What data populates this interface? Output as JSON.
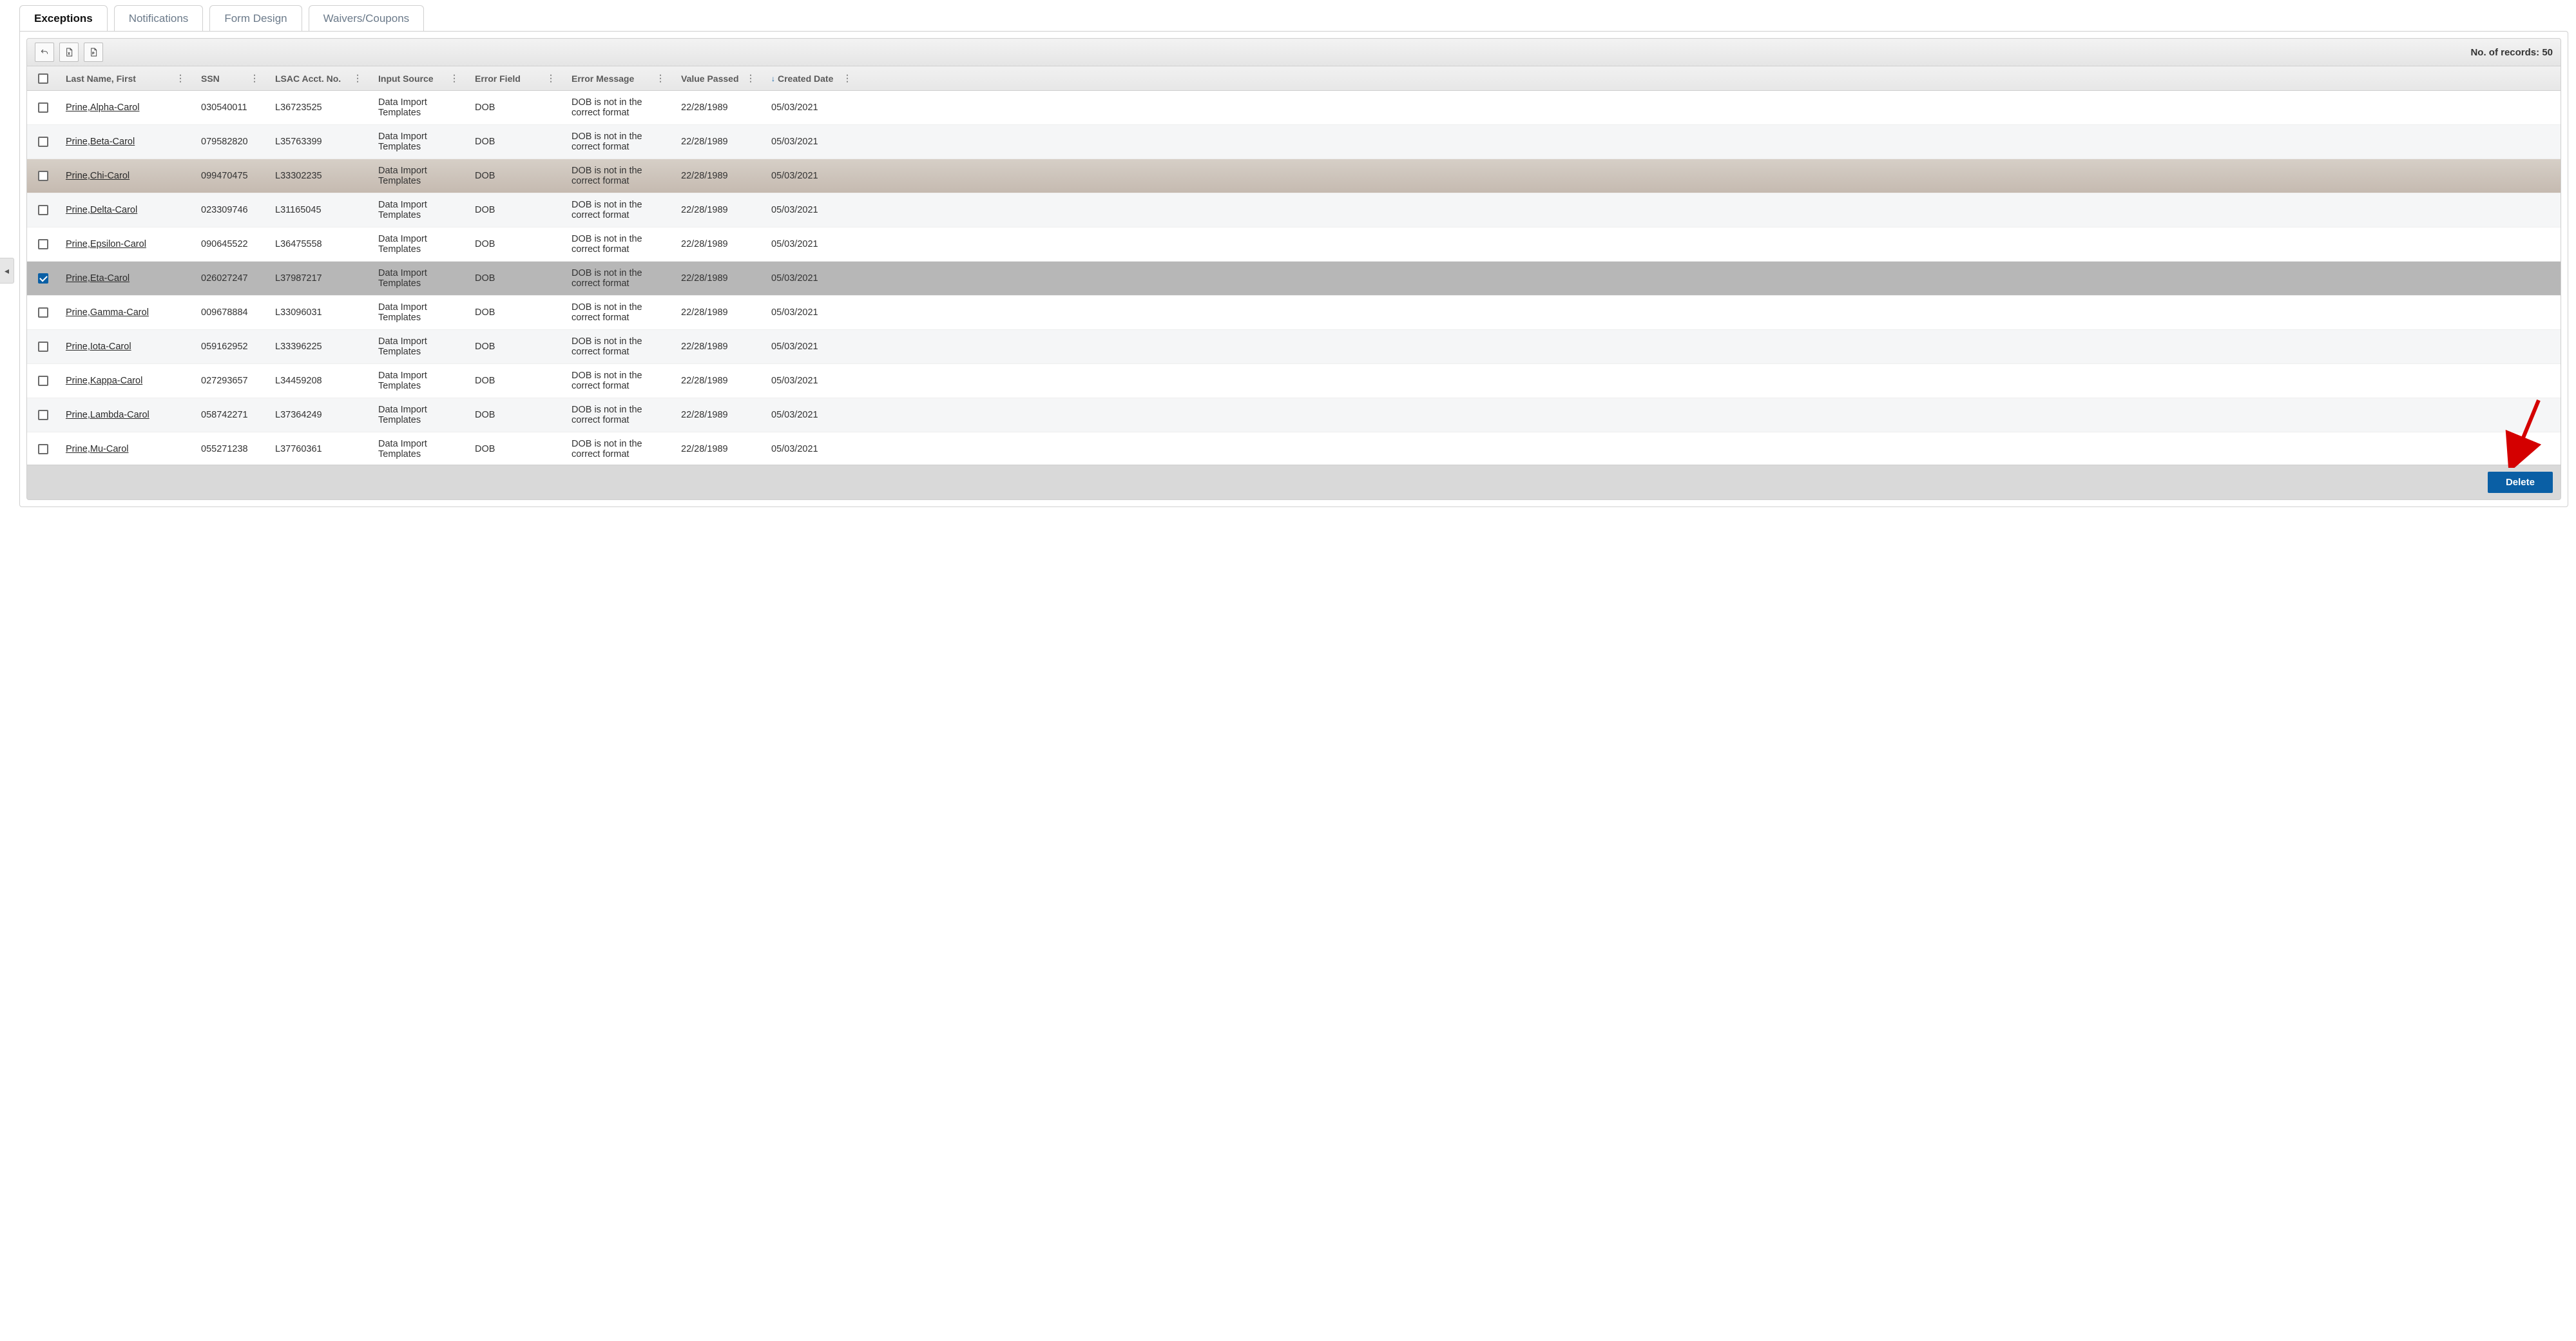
{
  "tabs": {
    "items": [
      {
        "label": "Exceptions",
        "active": true
      },
      {
        "label": "Notifications",
        "active": false
      },
      {
        "label": "Form Design",
        "active": false
      },
      {
        "label": "Waivers/Coupons",
        "active": false
      }
    ]
  },
  "toolbar": {
    "records_label": "No. of records:",
    "records_count": "50"
  },
  "columns": {
    "name": "Last Name, First",
    "ssn": "SSN",
    "lsac": "LSAC Acct. No.",
    "input": "Input Source",
    "err": "Error Field",
    "msg": "Error Message",
    "val": "Value Passed",
    "date": "Created Date"
  },
  "sort": {
    "column": "date",
    "dir": "asc"
  },
  "rows": [
    {
      "checked": false,
      "state": "",
      "name": "Prine,Alpha-Carol",
      "ssn": "030540011",
      "lsac": "L36723525",
      "input": "Data Import Templates",
      "err": "DOB",
      "msg": "DOB is not in the correct format",
      "val": "22/28/1989",
      "date": "05/03/2021"
    },
    {
      "checked": false,
      "state": "",
      "name": "Prine,Beta-Carol",
      "ssn": "079582820",
      "lsac": "L35763399",
      "input": "Data Import Templates",
      "err": "DOB",
      "msg": "DOB is not in the correct format",
      "val": "22/28/1989",
      "date": "05/03/2021"
    },
    {
      "checked": false,
      "state": "hover",
      "name": "Prine,Chi-Carol",
      "ssn": "099470475",
      "lsac": "L33302235",
      "input": "Data Import Templates",
      "err": "DOB",
      "msg": "DOB is not in the correct format",
      "val": "22/28/1989",
      "date": "05/03/2021"
    },
    {
      "checked": false,
      "state": "",
      "name": "Prine,Delta-Carol",
      "ssn": "023309746",
      "lsac": "L31165045",
      "input": "Data Import Templates",
      "err": "DOB",
      "msg": "DOB is not in the correct format",
      "val": "22/28/1989",
      "date": "05/03/2021"
    },
    {
      "checked": false,
      "state": "",
      "name": "Prine,Epsilon-Carol",
      "ssn": "090645522",
      "lsac": "L36475558",
      "input": "Data Import Templates",
      "err": "DOB",
      "msg": "DOB is not in the correct format",
      "val": "22/28/1989",
      "date": "05/03/2021"
    },
    {
      "checked": true,
      "state": "selected",
      "name": "Prine,Eta-Carol",
      "ssn": "026027247",
      "lsac": "L37987217",
      "input": "Data Import Templates",
      "err": "DOB",
      "msg": "DOB is not in the correct format",
      "val": "22/28/1989",
      "date": "05/03/2021"
    },
    {
      "checked": false,
      "state": "",
      "name": "Prine,Gamma-Carol",
      "ssn": "009678884",
      "lsac": "L33096031",
      "input": "Data Import Templates",
      "err": "DOB",
      "msg": "DOB is not in the correct format",
      "val": "22/28/1989",
      "date": "05/03/2021"
    },
    {
      "checked": false,
      "state": "",
      "name": "Prine,Iota-Carol",
      "ssn": "059162952",
      "lsac": "L33396225",
      "input": "Data Import Templates",
      "err": "DOB",
      "msg": "DOB is not in the correct format",
      "val": "22/28/1989",
      "date": "05/03/2021"
    },
    {
      "checked": false,
      "state": "",
      "name": "Prine,Kappa-Carol",
      "ssn": "027293657",
      "lsac": "L34459208",
      "input": "Data Import Templates",
      "err": "DOB",
      "msg": "DOB is not in the correct format",
      "val": "22/28/1989",
      "date": "05/03/2021"
    },
    {
      "checked": false,
      "state": "",
      "name": "Prine,Lambda-Carol",
      "ssn": "058742271",
      "lsac": "L37364249",
      "input": "Data Import Templates",
      "err": "DOB",
      "msg": "DOB is not in the correct format",
      "val": "22/28/1989",
      "date": "05/03/2021"
    },
    {
      "checked": false,
      "state": "",
      "name": "Prine,Mu-Carol",
      "ssn": "055271238",
      "lsac": "L37760361",
      "input": "Data Import Templates",
      "err": "DOB",
      "msg": "DOB is not in the correct format",
      "val": "22/28/1989",
      "date": "05/03/2021"
    }
  ],
  "footer": {
    "delete_label": "Delete"
  }
}
